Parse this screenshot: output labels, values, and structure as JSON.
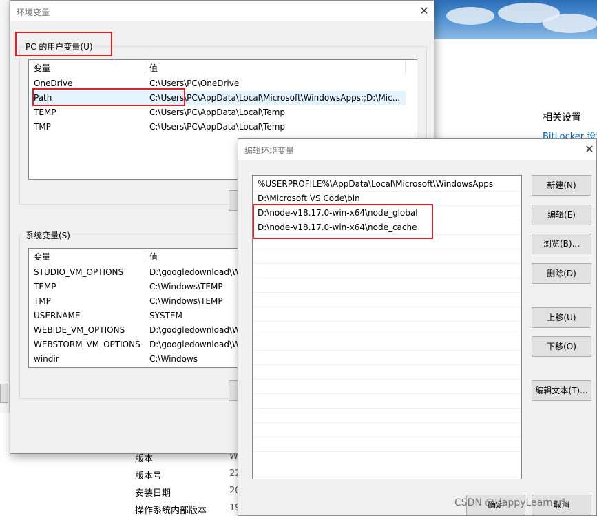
{
  "background": {
    "related_settings": "相关设置",
    "bitlocker": "BitLocker 设置",
    "specs": [
      {
        "label": "版本",
        "value": "W"
      },
      {
        "label": "版本号",
        "value": "22"
      },
      {
        "label": "安装日期",
        "value": "20"
      },
      {
        "label": "操作系统内部版本",
        "value": "19"
      }
    ]
  },
  "env_dialog": {
    "title": "环境变量",
    "user_group_label": "PC 的用户变量(U)",
    "system_group_label": "系统变量(S)",
    "columns": {
      "name": "变量",
      "value": "值"
    },
    "user_vars": [
      {
        "name": "OneDrive",
        "value": "C:\\Users\\PC\\OneDrive"
      },
      {
        "name": "Path",
        "value": "C:\\Users\\PC\\AppData\\Local\\Microsoft\\WindowsApps;;D:\\Mic..."
      },
      {
        "name": "TEMP",
        "value": "C:\\Users\\PC\\AppData\\Local\\Temp"
      },
      {
        "name": "TMP",
        "value": "C:\\Users\\PC\\AppData\\Local\\Temp"
      }
    ],
    "system_vars": [
      {
        "name": "STUDIO_VM_OPTIONS",
        "value": "D:\\googledownload\\W"
      },
      {
        "name": "TEMP",
        "value": "C:\\Windows\\TEMP"
      },
      {
        "name": "TMP",
        "value": "C:\\Windows\\TEMP"
      },
      {
        "name": "USERNAME",
        "value": "SYSTEM"
      },
      {
        "name": "WEBIDE_VM_OPTIONS",
        "value": "D:\\googledownload\\W"
      },
      {
        "name": "WEBSTORM_VM_OPTIONS",
        "value": "D:\\googledownload\\W"
      },
      {
        "name": "windir",
        "value": "C:\\Windows"
      }
    ]
  },
  "edit_dialog": {
    "title": "编辑环境变量",
    "entries": [
      "%USERPROFILE%\\AppData\\Local\\Microsoft\\WindowsApps",
      "D:\\Microsoft VS Code\\bin",
      "D:\\node-v18.17.0-win-x64\\node_global",
      "D:\\node-v18.17.0-win-x64\\node_cache"
    ],
    "buttons": {
      "new": "新建(N)",
      "edit": "编辑(E)",
      "browse": "浏览(B)...",
      "delete": "删除(D)",
      "move_up": "上移(U)",
      "move_down": "下移(O)",
      "edit_text": "编辑文本(T)...",
      "ok": "确定",
      "cancel": "取消"
    }
  },
  "watermark": "CSDN @HappyLearnerL",
  "colors": {
    "highlight": "#d6252a",
    "selected_row": "#e5f3ff",
    "link": "#0066b4"
  }
}
